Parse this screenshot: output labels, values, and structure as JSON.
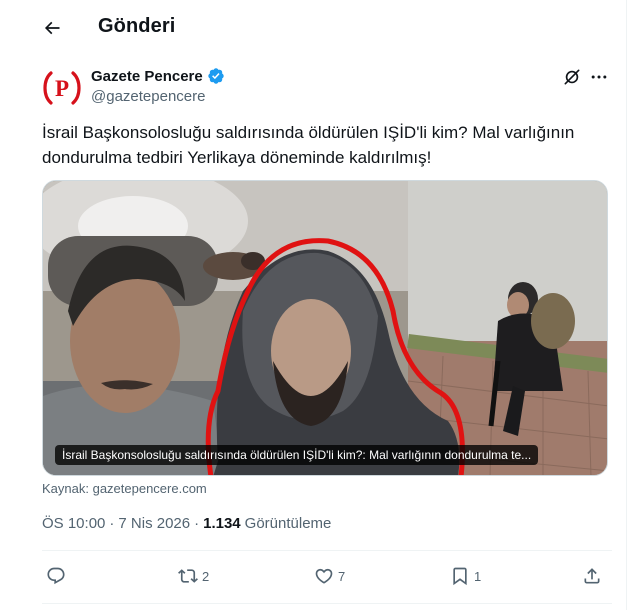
{
  "header": {
    "title": "Gönderi",
    "back_icon": "arrow-left-icon"
  },
  "author": {
    "avatar_text": "(P)",
    "name": "Gazete Pencere",
    "handle": "@gazetepencere",
    "verified": true,
    "brand_color": "#d6111b",
    "verified_color": "#1d9bf0"
  },
  "tweet": {
    "text": "İsrail Başkonsolosluğu saldırısında öldürülen IŞİD'li kim? Mal varlığının dondurulma tedbiri Yerlikaya döneminde kaldırılmış!",
    "media_caption": "İsrail Başkonsolosluğu saldırısında öldürülen IŞİD'li kim?: Mal varlığının dondurulma te...",
    "source": "Kaynak: gazetepencere.com",
    "time": "ÖS 10:00",
    "separator": "·",
    "date": "7 Nis 2026",
    "views_count": "1.134",
    "views_label": "Görüntüleme"
  },
  "actions": {
    "reply_count": "",
    "retweet_count": "2",
    "like_count": "7",
    "bookmark_count": "1",
    "share_count": ""
  },
  "colors": {
    "text_primary": "#0f1419",
    "text_secondary": "#536471",
    "highlight_red": "#e01212"
  }
}
